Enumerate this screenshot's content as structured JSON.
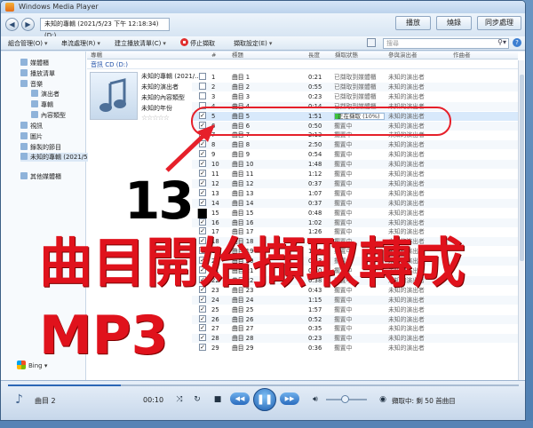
{
  "window": {
    "title": "Windows Media Player"
  },
  "nav": {
    "breadcrumb": "未知的專輯 (2021/5/23 下午 12:18:34) (D:)"
  },
  "tabs": [
    "播放",
    "燒錄",
    "同步處理"
  ],
  "toolbar": {
    "organize": "組合管理(O)",
    "stream": "串流處理(R)",
    "create_playlist": "建立播放清單(C)",
    "stop_rip": "停止擷取",
    "rip_settings": "擷取設定(E)",
    "search_placeholder": "搜尋"
  },
  "sidebar": {
    "items": [
      "媒體櫃",
      "播放清單",
      "音樂",
      "演出者",
      "專輯",
      "內容類型",
      "視訊",
      "圖片",
      "錄製的節目",
      "未知的專輯 (2021/5",
      "其他媒體櫃"
    ],
    "bing": "Bing"
  },
  "columns": [
    "專輯",
    "#",
    "標題",
    "長度",
    "擷取狀態",
    "參與演出者",
    "作曲者"
  ],
  "album": {
    "header": "音訊 CD (D:)",
    "title": "未知的專輯 (2021/...",
    "artist": "未知的演出者",
    "genre": "未知的內容類型",
    "year": "未知的年份",
    "rating": "☆☆☆☆☆"
  },
  "tracks": [
    {
      "num": "1",
      "title": "曲目 1",
      "length": "0:21",
      "status": "已擷取到媒體櫃",
      "artist": "未知的演出者"
    },
    {
      "num": "2",
      "title": "曲目 2",
      "length": "0:55",
      "status": "已擷取到媒體櫃",
      "artist": "未知的演出者"
    },
    {
      "num": "3",
      "title": "曲目 3",
      "length": "0:23",
      "status": "已擷取到媒體櫃",
      "artist": "未知的演出者"
    },
    {
      "num": "4",
      "title": "曲目 4",
      "length": "0:14",
      "status": "已擷取到媒體櫃",
      "artist": "未知的演出者"
    },
    {
      "num": "5",
      "title": "曲目 5",
      "length": "1:51",
      "status": "正在擷取 (10%)",
      "artist": "未知的演出者",
      "progress": 0.1
    },
    {
      "num": "6",
      "title": "曲目 6",
      "length": "0:50",
      "status": "擱置中",
      "artist": "未知的演出者"
    },
    {
      "num": "7",
      "title": "曲目 7",
      "length": "2:13",
      "status": "擱置中",
      "artist": "未知的演出者"
    },
    {
      "num": "8",
      "title": "曲目 8",
      "length": "2:50",
      "status": "擱置中",
      "artist": "未知的演出者"
    },
    {
      "num": "9",
      "title": "曲目 9",
      "length": "0:54",
      "status": "擱置中",
      "artist": "未知的演出者"
    },
    {
      "num": "10",
      "title": "曲目 10",
      "length": "1:48",
      "status": "擱置中",
      "artist": "未知的演出者"
    },
    {
      "num": "11",
      "title": "曲目 11",
      "length": "1:12",
      "status": "擱置中",
      "artist": "未知的演出者"
    },
    {
      "num": "12",
      "title": "曲目 12",
      "length": "0:37",
      "status": "擱置中",
      "artist": "未知的演出者"
    },
    {
      "num": "13",
      "title": "曲目 13",
      "length": "1:07",
      "status": "擱置中",
      "artist": "未知的演出者"
    },
    {
      "num": "14",
      "title": "曲目 14",
      "length": "0:37",
      "status": "擱置中",
      "artist": "未知的演出者"
    },
    {
      "num": "15",
      "title": "曲目 15",
      "length": "0:48",
      "status": "擱置中",
      "artist": "未知的演出者"
    },
    {
      "num": "16",
      "title": "曲目 16",
      "length": "1:02",
      "status": "擱置中",
      "artist": "未知的演出者"
    },
    {
      "num": "17",
      "title": "曲目 17",
      "length": "1:26",
      "status": "擱置中",
      "artist": "未知的演出者"
    },
    {
      "num": "18",
      "title": "曲目 18",
      "length": "1:12",
      "status": "擱置中",
      "artist": "未知的演出者"
    },
    {
      "num": "19",
      "title": "曲目 19",
      "length": "1:25",
      "status": "擱置中",
      "artist": "未知的演出者"
    },
    {
      "num": "20",
      "title": "曲目 20",
      "length": "0:33",
      "status": "擱置中",
      "artist": "未知的演出者"
    },
    {
      "num": "21",
      "title": "曲目 21",
      "length": "0:30",
      "status": "擱置中",
      "artist": "未知的演出者"
    },
    {
      "num": "22",
      "title": "曲目 22",
      "length": "0:38",
      "status": "擱置中",
      "artist": "未知的演出者"
    },
    {
      "num": "23",
      "title": "曲目 23",
      "length": "0:43",
      "status": "擱置中",
      "artist": "未知的演出者"
    },
    {
      "num": "24",
      "title": "曲目 24",
      "length": "1:15",
      "status": "擱置中",
      "artist": "未知的演出者"
    },
    {
      "num": "25",
      "title": "曲目 25",
      "length": "1:57",
      "status": "擱置中",
      "artist": "未知的演出者"
    },
    {
      "num": "26",
      "title": "曲目 26",
      "length": "0:52",
      "status": "擱置中",
      "artist": "未知的演出者"
    },
    {
      "num": "27",
      "title": "曲目 27",
      "length": "0:35",
      "status": "擱置中",
      "artist": "未知的演出者"
    },
    {
      "num": "28",
      "title": "曲目 28",
      "length": "0:23",
      "status": "擱置中",
      "artist": "未知的演出者"
    },
    {
      "num": "29",
      "title": "曲目 29",
      "length": "0:36",
      "status": "擱置中",
      "artist": "未知的演出者"
    }
  ],
  "player": {
    "now_playing": "曲目 2",
    "time": "00:10",
    "seek_progress": 0.22,
    "rip_status": "擷取中: 剩 50 首曲目",
    "volume": 0.45
  },
  "annotation": {
    "step": "13.",
    "line1": "曲目開始擷取轉成",
    "line2": "MP3",
    "color": "#e0121c"
  }
}
